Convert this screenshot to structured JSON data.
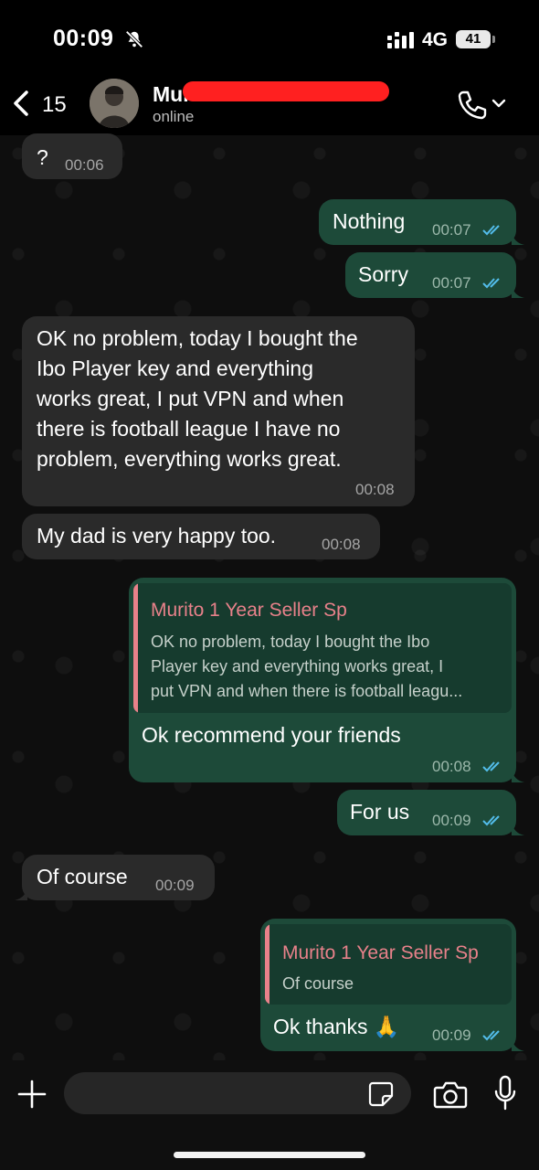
{
  "status_bar": {
    "time": "00:09",
    "network": "4G",
    "battery": "41"
  },
  "header": {
    "back_count": "15",
    "contact_name": "Muri",
    "contact_status": "online"
  },
  "messages": [
    {
      "direction": "incoming",
      "text": "?",
      "time": "00:06"
    },
    {
      "direction": "outgoing",
      "text": "Nothing",
      "time": "00:07",
      "read": true
    },
    {
      "direction": "outgoing",
      "text": "Sorry",
      "time": "00:07",
      "read": true
    },
    {
      "direction": "incoming",
      "lines": [
        "OK no problem, today I bought the",
        "Ibo Player key and everything",
        "works great, I put VPN and when",
        "there is football league I have no",
        "problem, everything works great."
      ],
      "time": "00:08"
    },
    {
      "direction": "incoming",
      "text": "My dad is very happy too.",
      "time": "00:08"
    },
    {
      "direction": "outgoing",
      "quote": {
        "author": "Murito 1 Year Seller Sp",
        "lines": [
          "OK no problem, today I bought the Ibo",
          "Player key and everything works great, I",
          "put VPN and when there is football leagu..."
        ]
      },
      "text": "Ok recommend your friends",
      "time": "00:08",
      "read": true
    },
    {
      "direction": "outgoing",
      "text": "For us",
      "time": "00:09",
      "read": true
    },
    {
      "direction": "incoming",
      "text": "Of course",
      "time": "00:09"
    },
    {
      "direction": "outgoing",
      "quote": {
        "author": "Murito 1 Year Seller Sp",
        "text": "Of course"
      },
      "text": "Ok thanks 🙏",
      "time": "00:09",
      "read": true
    }
  ],
  "composer": {
    "placeholder": ""
  },
  "colors": {
    "incoming_bubble": "#2a2a2a",
    "outgoing_bubble": "#1d4a39",
    "read_ticks": "#53bdeb",
    "quote_author": "#e8818a",
    "redaction": "#ff2020"
  },
  "icons": [
    "bell-slash-icon",
    "signal-icon",
    "back-chevron-icon",
    "phone-icon",
    "chevron-down-icon",
    "double-check-icon",
    "plus-icon",
    "sticker-icon",
    "camera-icon",
    "microphone-icon"
  ]
}
